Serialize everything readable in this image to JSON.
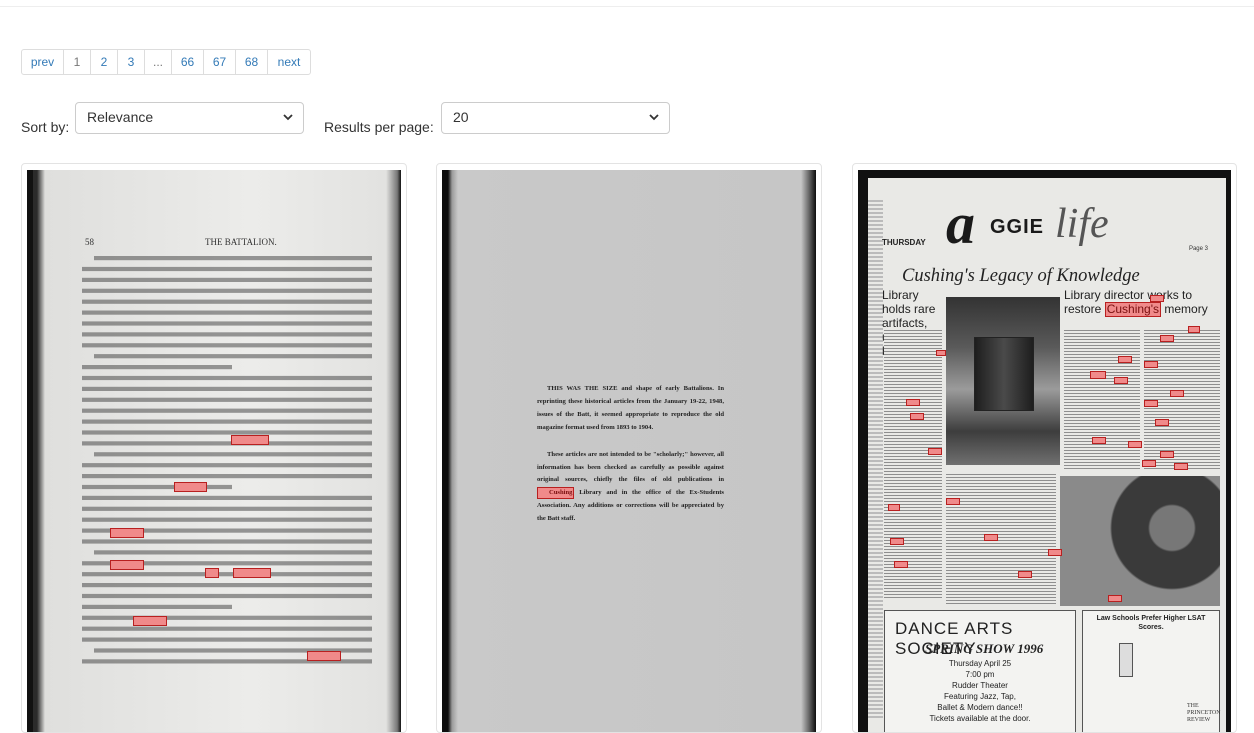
{
  "pagination": {
    "prev": "prev",
    "pages": [
      "1",
      "2",
      "3",
      "...",
      "66",
      "67",
      "68"
    ],
    "next": "next"
  },
  "sort": {
    "label": "Sort by:",
    "value": "Relevance"
  },
  "per_page": {
    "label": "Results per page:",
    "value": "20"
  },
  "results": [
    {
      "page_number": "58",
      "running_head": "THE BATTALION.",
      "highlight_term": "Cushing"
    },
    {
      "paragraph_1": "THIS WAS THE SIZE and shape of early Battalions. In reprinting these historical articles from the January 19-22, 1948, issues of the Batt, it seemed appropriate to reproduce the old magazine format used from 1893 to 1904.",
      "paragraph_2_before": "These articles are not intended to be \"scholarly;\" however, all information has been checked as carefully as possible against original sources, chiefly the files of old publications in",
      "paragraph_2_highlight": "Cushing",
      "paragraph_2_after": "Library and in the office of the Ex-Students Association. Any additions or corrections will be appreciated by the Batt staff."
    },
    {
      "day": "THURSDAY",
      "page": "Page 3",
      "logo_a": "a",
      "logo_ggie": "GGIE",
      "logo_life": "life",
      "headline": "Cushing's Legacy of Knowledge",
      "left_sub": "Library holds rare artifacts, unique books",
      "right_sub_before": "Library director works to restore",
      "right_sub_highlight": "Cushing's",
      "right_sub_after": "memory",
      "ad_title": "DANCE ARTS SOCIETY",
      "ad_show": "SPRING SHOW 1996",
      "ad_date": "Thursday April 25",
      "ad_time": "7:00 pm",
      "ad_venue": "Rudder Theater",
      "ad_featuring": "Featuring Jazz, Tap,",
      "ad_styles": "Ballet & Modern dance!!",
      "ad_tickets": "Tickets available at the door.",
      "ad2_title": "Law Schools Prefer Higher LSAT Scores.",
      "ad2_brand": "THE PRINCETON REVIEW"
    }
  ]
}
